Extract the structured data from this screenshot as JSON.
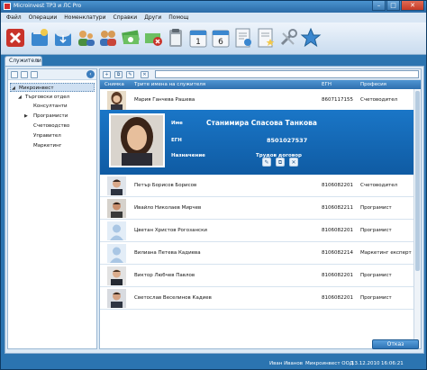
{
  "window": {
    "title": "Microinvest ТРЗ и ЛС Pro"
  },
  "menu": [
    "Файл",
    "Операции",
    "Номенклатури",
    "Справки",
    "Други",
    "Помощ"
  ],
  "toolbar_icons": [
    "exit-icon",
    "new-document-icon",
    "cloud-import-icon",
    "group-add-icon",
    "users-icon",
    "money-icon",
    "cancel-money-icon",
    "clipboard-icon",
    "calendar-1-icon",
    "calendar-6-icon",
    "document-check-icon",
    "document-star-icon",
    "tools-icon",
    "star-icon"
  ],
  "tab": {
    "label": "Служители",
    "close": "x"
  },
  "tree": [
    {
      "label": "Микроинвест",
      "selected": true
    },
    {
      "label": "Търговски отдел"
    },
    {
      "label": "Консултанти"
    },
    {
      "label": "Програмисти"
    },
    {
      "label": "Счетоводство"
    },
    {
      "label": "Управител"
    },
    {
      "label": "Маркетинг"
    }
  ],
  "grid": {
    "headers": [
      "Снимка",
      "Трите имена на служителя",
      "ЕГН",
      "Професия"
    ],
    "rows": [
      {
        "name": "Мария Ганчева Рашева",
        "egn": "8607117155",
        "profession": "Счетоводител"
      },
      {
        "name": "Петър Борисов Борисов",
        "egn": "8106082201",
        "profession": "Счетоводител"
      },
      {
        "name": "Ивайло Николаев Мирчев",
        "egn": "8106082211",
        "profession": "Програмист"
      },
      {
        "name": "Цветан Христов Рогозански",
        "egn": "8106082201",
        "profession": "Програмист"
      },
      {
        "name": "Вилиана Петева Кадиева",
        "egn": "8106082214",
        "profession": "Маркетинг експерт"
      },
      {
        "name": "Виктор Любчев Павлов",
        "egn": "8106082201",
        "profession": "Програмист"
      },
      {
        "name": "Светослав Веселинов Кадиев",
        "egn": "8106082201",
        "profession": "Програмист"
      }
    ],
    "expanded": {
      "name_label": "Име",
      "name": "Станимира Спасова Танкова",
      "egn_label": "ЕГН",
      "egn": "8501027537",
      "position_label": "Назначение",
      "contract": "Трудов договор"
    }
  },
  "close_button": "Отказ",
  "status": {
    "user": "Иван Иванов",
    "company": "Микроинвест ООД",
    "date": "13.12.2010",
    "time": "16:06:21"
  },
  "colors": {
    "header": "#2e6fae",
    "expanded": "#1a76c7",
    "window": "#2b74b0"
  }
}
